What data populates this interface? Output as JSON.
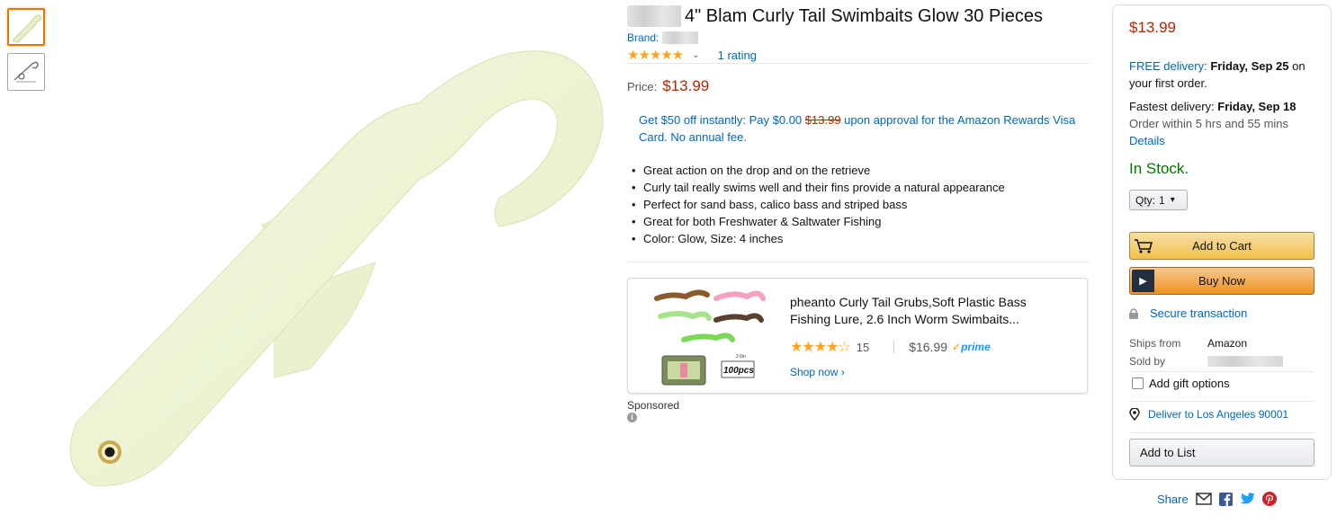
{
  "product": {
    "title": "4\" Blam Curly Tail Swimbaits Glow 30 Pieces",
    "brand_label": "Brand:",
    "stars": "★★★★★",
    "rating_link": "1 rating",
    "price_label": "Price:",
    "price": "$13.99",
    "promo_prefix": "Get $50 off instantly: Pay $0.00",
    "promo_strike": "$13.99",
    "promo_suffix": "upon approval for the Amazon Rewards Visa Card. No annual fee.",
    "bullets": [
      "Great action on the drop and on the retrieve",
      "Curly tail really swims well and their fins provide a natural appearance",
      "Perfect for sand bass, calico bass and striped bass",
      "Great for both Freshwater & Saltwater Fishing",
      "Color: Glow, Size: 4 inches"
    ]
  },
  "ad": {
    "title": "pheanto Curly Tail Grubs,Soft Plastic Bass Fishing Lure, 2.6 Inch Worm Swimbaits...",
    "stars": "★★★★☆",
    "review_count": "15",
    "price": "$16.99",
    "prime_label": "prime",
    "shop_now": "Shop now ›",
    "img_label_size": "2.6in",
    "img_label_count": "100pcs",
    "sponsored_label": "Sponsored"
  },
  "buybox": {
    "price": "$13.99",
    "free_delivery_link": "FREE delivery:",
    "free_delivery_date": "Friday, Sep 25",
    "free_delivery_suffix": "on your first order.",
    "fastest_label": "Fastest delivery:",
    "fastest_date": "Friday, Sep 18",
    "order_within": "Order within 5 hrs and 55 mins",
    "details_link": "Details",
    "stock_status": "In Stock.",
    "qty_label": "Qty:",
    "qty_value": "1",
    "add_to_cart": "Add to Cart",
    "buy_now": "Buy Now",
    "secure": "Secure transaction",
    "ships_from_label": "Ships from",
    "ships_from_value": "Amazon",
    "sold_by_label": "Sold by",
    "gift_label": "Add gift options",
    "deliver_to": "Deliver to Los Angeles 90001",
    "add_to_list": "Add to List"
  },
  "share": {
    "label": "Share"
  },
  "colors": {
    "price_red": "#b12704",
    "link_blue": "#0066c0",
    "stock_green": "#007600",
    "star_orange": "#ffa41c",
    "lure_glow": "#eef6d4"
  }
}
